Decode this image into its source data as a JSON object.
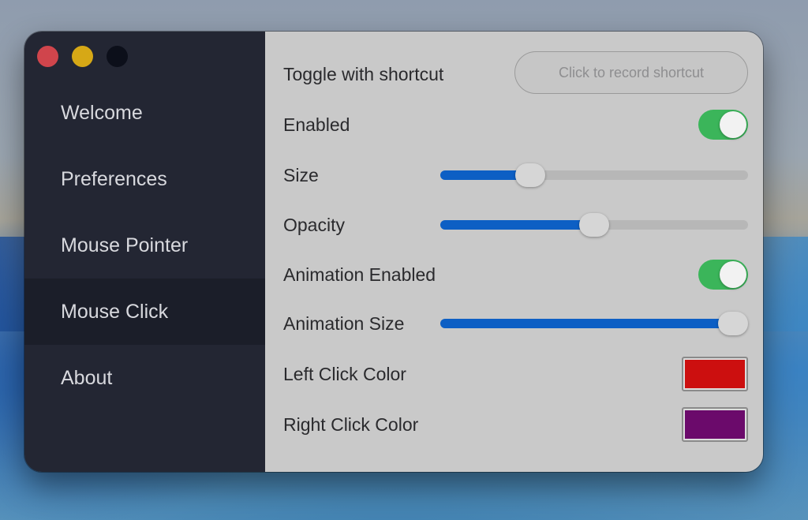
{
  "window": {
    "traffic_lights": {
      "close": "#d0454c",
      "minimize": "#d6a816",
      "maximize": "#0c0f1a"
    }
  },
  "sidebar": {
    "items": [
      {
        "label": "Welcome",
        "active": false
      },
      {
        "label": "Preferences",
        "active": false
      },
      {
        "label": "Mouse Pointer",
        "active": false
      },
      {
        "label": "Mouse Click",
        "active": true
      },
      {
        "label": "About",
        "active": false
      }
    ]
  },
  "settings": {
    "shortcut": {
      "label": "Toggle with shortcut",
      "button_text": "Click to record shortcut"
    },
    "enabled": {
      "label": "Enabled",
      "value": true
    },
    "size": {
      "label": "Size",
      "value_fraction": 0.27
    },
    "opacity": {
      "label": "Opacity",
      "value_fraction": 0.5
    },
    "animation_enabled": {
      "label": "Animation Enabled",
      "value": true
    },
    "animation_size": {
      "label": "Animation Size",
      "value_fraction": 1.0
    },
    "left_click_color": {
      "label": "Left Click Color",
      "color": "#cc0f0f"
    },
    "right_click_color": {
      "label": "Right Click Color",
      "color": "#6b0a6b"
    }
  },
  "colors": {
    "accent": "#0d5fc4",
    "toggle_on": "#3bb55a",
    "sidebar_bg": "#232633",
    "content_bg": "#c9c9c9"
  }
}
